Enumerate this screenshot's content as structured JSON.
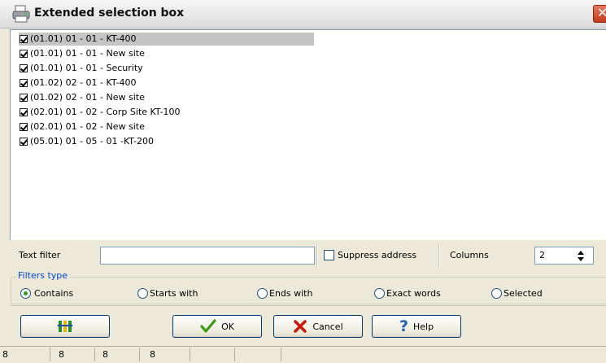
{
  "window": {
    "title": "Extended selection box"
  },
  "list": {
    "items": [
      {
        "label": "(01.01) 01 - 01 - KT-400",
        "checked": true,
        "selected": true
      },
      {
        "label": "(01.01) 01 - 01 - New site",
        "checked": true,
        "selected": false
      },
      {
        "label": "(01.01) 01 - 01 - Security",
        "checked": true,
        "selected": false
      },
      {
        "label": "(01.02) 02 - 01 - KT-400",
        "checked": true,
        "selected": false
      },
      {
        "label": "(01.02) 02 - 01 - New site",
        "checked": true,
        "selected": false
      },
      {
        "label": "(02.01) 01 - 02 - Corp Site KT-100",
        "checked": true,
        "selected": false
      },
      {
        "label": "(02.01) 01 - 02 - New site",
        "checked": true,
        "selected": false
      },
      {
        "label": "(05.01) 01 - 05 - 01 -KT-200",
        "checked": true,
        "selected": false
      }
    ]
  },
  "filter": {
    "text_filter_label": "Text filter",
    "text_filter_value": "",
    "suppress_address_label": "Suppress address",
    "suppress_address_checked": false,
    "columns_label": "Columns",
    "columns_value": "2"
  },
  "filters_type": {
    "legend": "Filters type",
    "selected": "Contains",
    "options": [
      "Contains",
      "Starts with",
      "Ends with",
      "Exact words",
      "Selected"
    ]
  },
  "buttons": {
    "ok": "OK",
    "cancel": "Cancel",
    "help": "Help"
  },
  "statusbar": {
    "cells": [
      "8",
      "8",
      "8",
      "8",
      "",
      "",
      ""
    ]
  },
  "colors": {
    "accent": "#0046d5",
    "selection": "#c5c5c5",
    "ok_check": "#3a9b12",
    "cancel_x": "#c8190f",
    "help_q": "#1d5fbf"
  }
}
